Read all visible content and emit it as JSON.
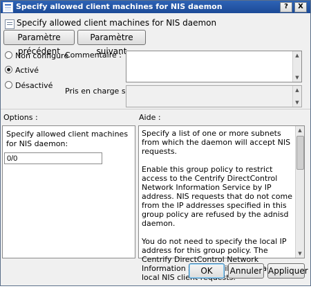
{
  "window": {
    "title": "Specify allowed client machines for NIS daemon",
    "help_glyph": "?",
    "close_glyph": "X"
  },
  "header": {
    "title": "Specify allowed client machines for NIS daemon",
    "icon": "policy-setting-icon"
  },
  "nav": {
    "prev_label": "Paramètre précédent",
    "next_label": "Paramètre suivant"
  },
  "state": {
    "options": [
      "Non configuré",
      "Activé",
      "Désactivé"
    ],
    "selected": "Activé"
  },
  "comment": {
    "label": "Commentaire :"
  },
  "supported_on": {
    "label": "Pris en charge sur :"
  },
  "options": {
    "label": "Options :",
    "field_label": "Specify allowed client machines for NIS daemon:",
    "field_value": "0/0"
  },
  "help": {
    "label": "Aide :",
    "paragraphs": [
      "Specify a list of one or more subnets from which the daemon will accept NIS requests.",
      "Enable this group policy to restrict access to the Centrify DirectControl Network Information Service by IP address. NIS requests that do not come from the IP addresses specified in this group policy are refused by the adnisd daemon.",
      "You do not need to specify the local IP address for this group policy. The Centrify DirectControl Network Information Service will always accept local NIS client requests."
    ]
  },
  "buttons": {
    "ok": "OK",
    "cancel": "Annuler",
    "apply": "Appliquer"
  },
  "colors": {
    "titlebar": "#1c4a97",
    "dialog_bg": "#f0f0f0",
    "default_button_border": "#3c7fb1"
  }
}
